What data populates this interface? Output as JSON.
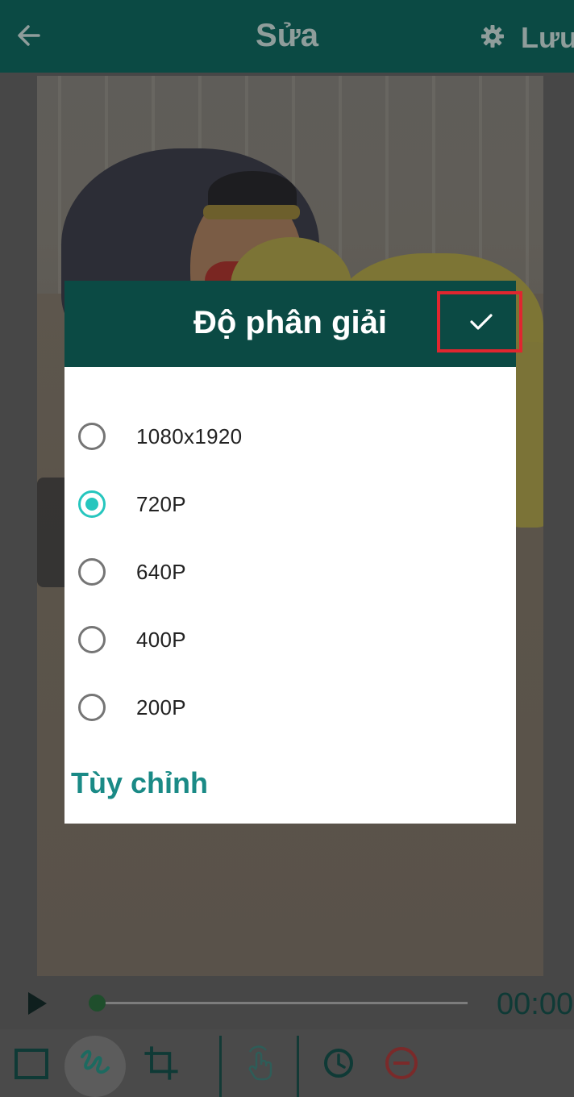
{
  "appbar": {
    "title": "Sửa",
    "save_label": "Lưu",
    "back_icon": "arrow-left-icon",
    "settings_icon": "gear-icon"
  },
  "player": {
    "time": "00:00",
    "progress": 0.0
  },
  "toolbar": {
    "items": [
      "rectangle-icon",
      "draw-icon",
      "crop-icon",
      "touch-icon",
      "clock-icon",
      "remove-icon"
    ],
    "active": "draw-icon"
  },
  "dialog": {
    "title": "Độ phân giải",
    "confirm_icon": "checkmark-icon",
    "options": [
      {
        "label": "1080x1920",
        "selected": false
      },
      {
        "label": "720P",
        "selected": true
      },
      {
        "label": "640P",
        "selected": false
      },
      {
        "label": "400P",
        "selected": false
      },
      {
        "label": "200P",
        "selected": false
      }
    ],
    "custom_label": "Tùy chỉnh"
  },
  "colors": {
    "header": "#0b4a44",
    "accent": "#26c6be",
    "link": "#1a8a86",
    "highlight": "#e0262f"
  }
}
